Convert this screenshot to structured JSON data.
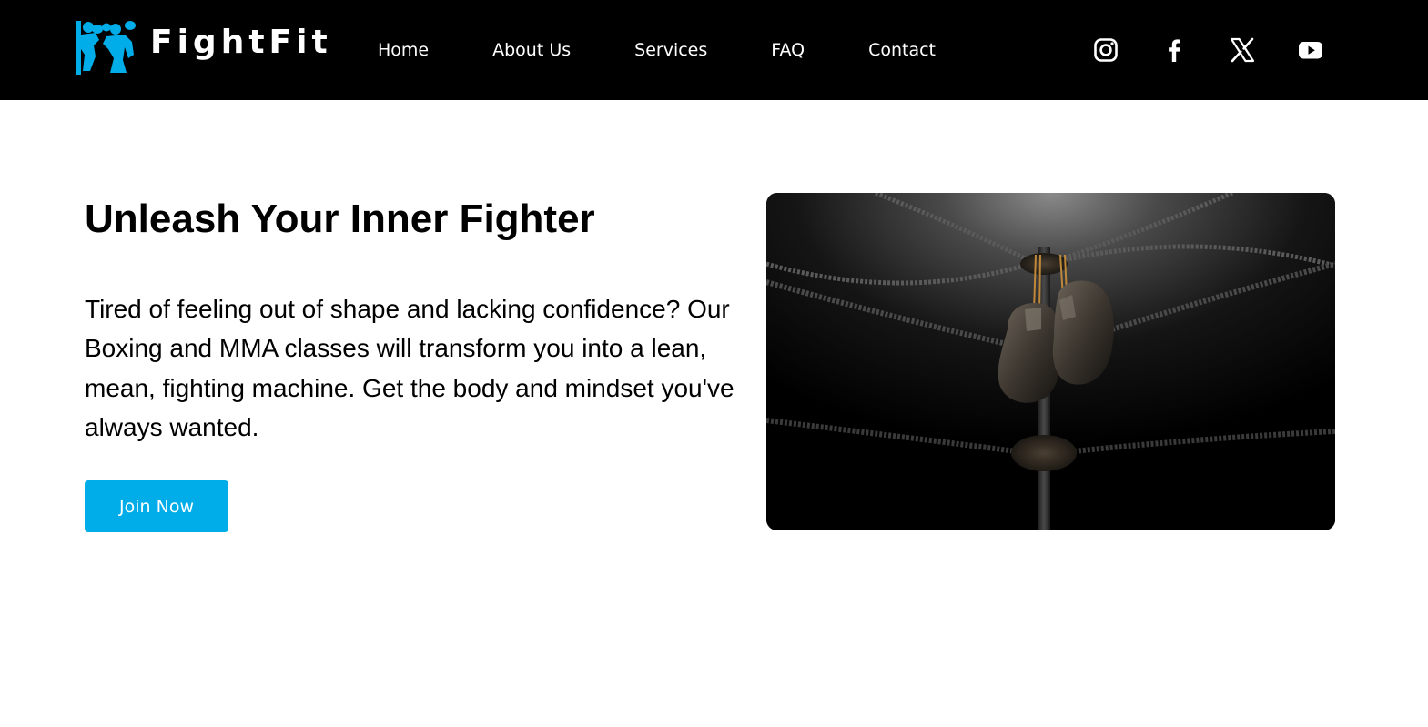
{
  "header": {
    "logo_text": "FightFit",
    "logo_icon": "boxers-icon",
    "brand_color": "#00ade9",
    "background": "#000000",
    "nav": [
      {
        "label": "Home"
      },
      {
        "label": "About Us"
      },
      {
        "label": "Services"
      },
      {
        "label": "FAQ"
      },
      {
        "label": "Contact"
      }
    ],
    "social": [
      {
        "icon": "instagram-icon"
      },
      {
        "icon": "facebook-icon"
      },
      {
        "icon": "x-twitter-icon"
      },
      {
        "icon": "youtube-icon"
      }
    ]
  },
  "hero": {
    "title": "Unleash Your Inner Fighter",
    "body": "Tired of feeling out of shape and lacking confidence? Our Boxing and MMA classes will transform you into a lean, mean, fighting machine. Get the body and mindset you've always wanted.",
    "cta_label": "Join Now",
    "cta_color": "#00ade9",
    "image_subject": "boxing-gloves-hanging-in-ring-corner"
  }
}
